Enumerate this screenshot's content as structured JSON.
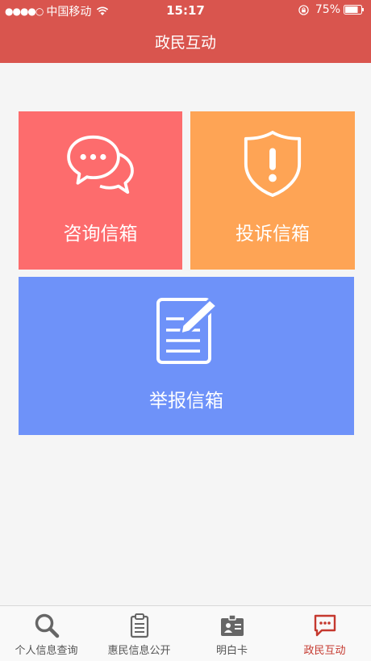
{
  "statusbar": {
    "carrier": "中国移动",
    "time": "15:17",
    "battery": "75%"
  },
  "header": {
    "title": "政民互动"
  },
  "tiles": [
    {
      "label": "咨询信箱",
      "icon": "chat-bubbles-icon",
      "color": "#fd6c6d"
    },
    {
      "label": "投诉信箱",
      "icon": "shield-alert-icon",
      "color": "#fea455"
    },
    {
      "label": "举报信箱",
      "icon": "document-edit-icon",
      "color": "#6e92f9"
    }
  ],
  "tabbar": {
    "items": [
      {
        "label": "个人信息查询",
        "icon": "search-icon"
      },
      {
        "label": "惠民信息公开",
        "icon": "clipboard-icon"
      },
      {
        "label": "明白卡",
        "icon": "id-card-icon"
      },
      {
        "label": "政民互动",
        "icon": "chat-icon"
      }
    ],
    "active_index": 3,
    "active_color": "#c5392f"
  }
}
